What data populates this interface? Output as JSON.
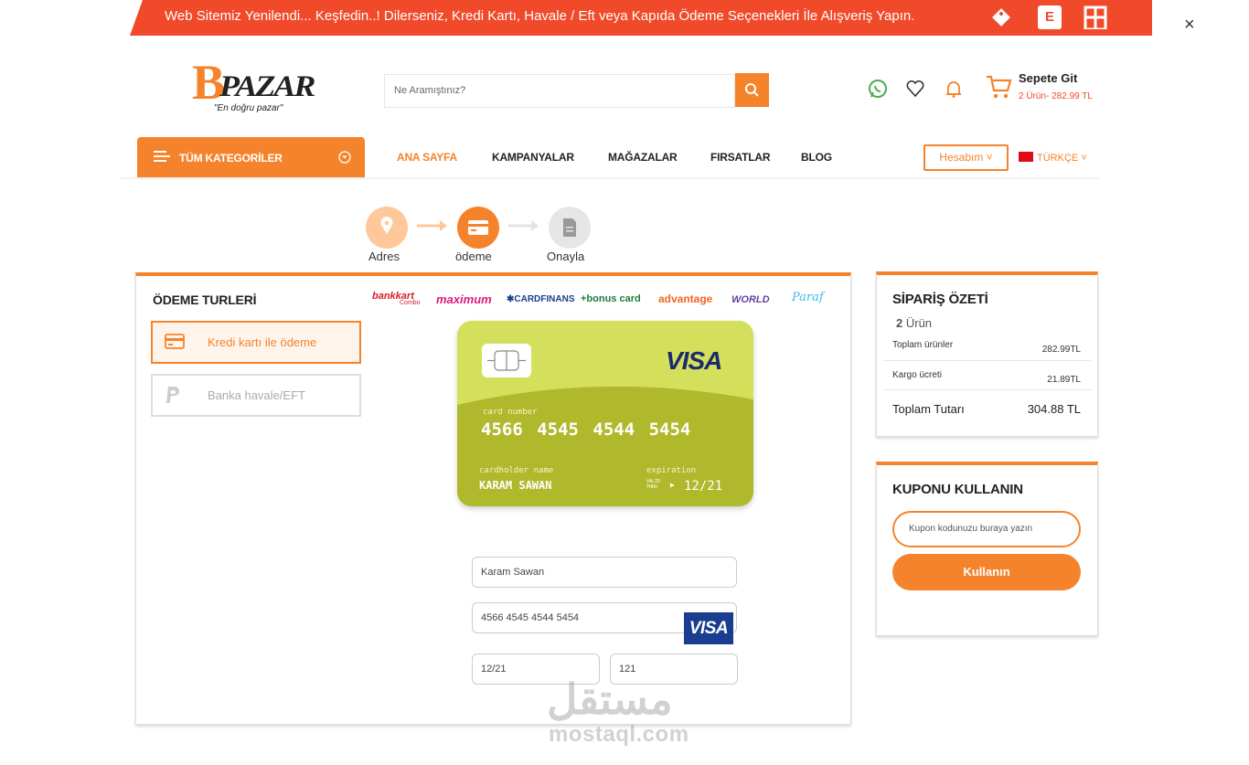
{
  "banner": {
    "text": "Web Sitemiz Yenilendi... Keşfedin..! Dilerseniz, Kredi Kartı, Havale / Eft veya Kapıda Ödeme Seçenekleri İle Alışveriş Yapın.",
    "close": "×",
    "icon_e": "E"
  },
  "header": {
    "logo_b": "B",
    "logo_rest": "PAZAR",
    "logo_tagline": "\"En doğru pazar\"",
    "search_placeholder": "Ne Aramıştınız?",
    "cart_title": "Sepete Git",
    "cart_sub": "2 Ürün- 282.99 TL"
  },
  "nav": {
    "categories": "TÜM KATEGORİLER",
    "items": [
      "ANA SAYFA",
      "KAMPANYALAR",
      "MAĞAZALAR",
      "FIRSATLAR",
      "BLOG"
    ],
    "account": "Hesabım ˅",
    "language": "TÜRKÇE ˅"
  },
  "steps": [
    {
      "label": "Adres"
    },
    {
      "label": "ödeme"
    },
    {
      "label": "Onayla"
    }
  ],
  "payment": {
    "title": "ÖDEME TURLERİ",
    "options": [
      "Kredi kartı ile ödeme",
      "Banka havale/EFT"
    ],
    "brands": [
      {
        "name": "bankkart",
        "sub": "Combo",
        "color": "#d71f26"
      },
      {
        "name": "maximum",
        "color": "#e0177d"
      },
      {
        "name": "CARDFINANS",
        "color": "#1b3e8c"
      },
      {
        "name": "+bonus card",
        "color": "#1f7a3a"
      },
      {
        "name": "advantage",
        "color": "#f26522"
      },
      {
        "name": "WORLD",
        "color": "#6a3ea1"
      },
      {
        "name": "Paraf",
        "color": "#3fb8e3"
      }
    ]
  },
  "card": {
    "brand": "VISA",
    "number_label": "card number",
    "number": "4566 4545 4544 5454",
    "holder_label": "cardholder name",
    "holder": "KARAM SAWAN",
    "exp_label": "expiration",
    "valid_thru": "VALID THRU",
    "exp": "12/21"
  },
  "form": {
    "name": "Karam Sawan",
    "number": "4566 4545 4544 5454",
    "badge": "VISA",
    "exp": "12/21",
    "cvv": "121"
  },
  "summary": {
    "title": "SİPARİŞ ÖZETİ",
    "count_num": "2",
    "count_label": "Ürün",
    "rows": [
      {
        "label": "Toplam ürünler",
        "value": "282.99TL"
      },
      {
        "label": "Kargo ücreti",
        "value": "21.89TL"
      }
    ],
    "total_label": "Toplam Tutarı",
    "total_value": "304.88 TL"
  },
  "coupon": {
    "title": "KUPONU KULLANIN",
    "placeholder": "Kupon kodunuzu buraya yazın",
    "button": "Kullanın"
  },
  "watermark": {
    "main": "مستقل",
    "sub": "mostaql.com"
  },
  "colors": {
    "accent": "#f5832b",
    "banner": "#f04a2b",
    "card": "#d4e05b",
    "card_lower": "#b0b82c"
  }
}
